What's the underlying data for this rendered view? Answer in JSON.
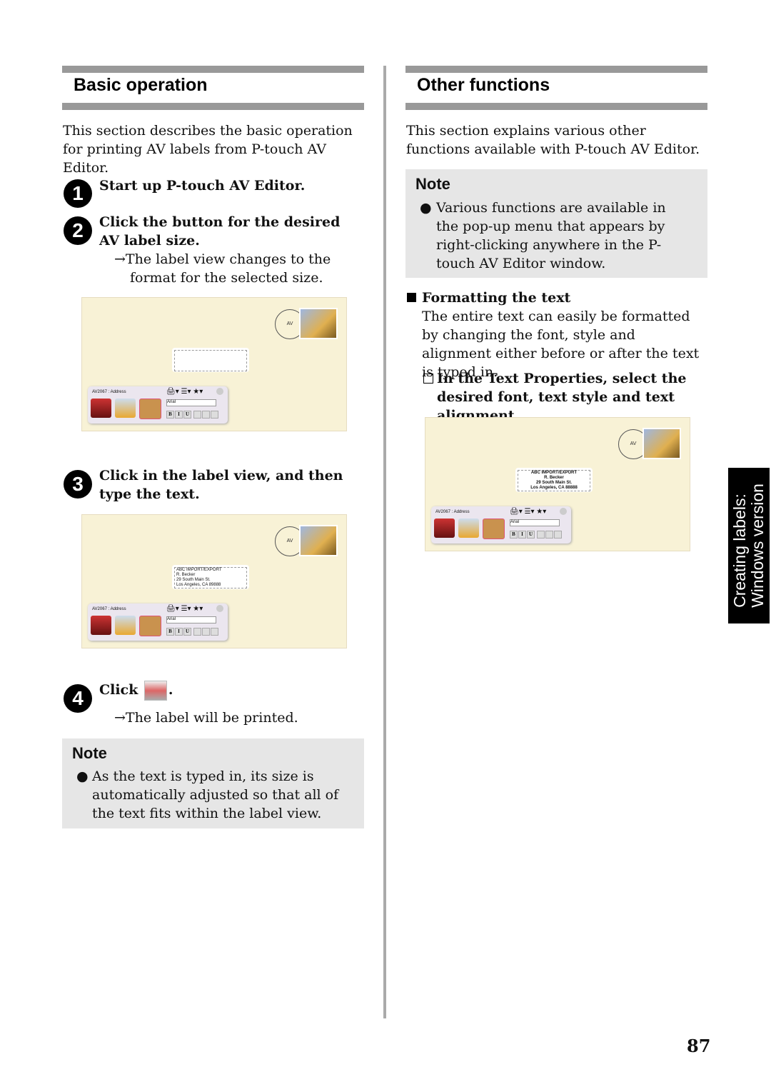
{
  "left": {
    "title": "Basic operation",
    "intro": "This section describes the basic operation for printing AV labels from P-touch AV Editor.",
    "steps": [
      {
        "num": "1",
        "text": "Start up P-touch AV Editor."
      },
      {
        "num": "2",
        "text": "Click the button for the desired AV label size.",
        "result": "→The label view changes to the format for the selected size."
      },
      {
        "num": "3",
        "text": "Click in the label view, and then type the text."
      },
      {
        "num": "4",
        "text": "Click",
        "after": ".",
        "result": "→The label will be printed."
      }
    ],
    "note": {
      "title": "Note",
      "bullet": "●",
      "text": "As the text is typed in, its size is automatically adjusted so that all of the text fits within the label view."
    }
  },
  "right": {
    "title": "Other functions",
    "intro": "This section explains various other functions available with P-touch AV Editor.",
    "note": {
      "title": "Note",
      "bullet": "●",
      "text": "Various functions are available in the pop-up menu that appears by right-clicking anywhere in the P-touch AV Editor window."
    },
    "subheading": "Formatting the text",
    "subtext": "The entire text can easily be formatted by changing the font, style and alignment either before or after the text is typed in.",
    "instruction": "In the Text Properties, select the desired font, text style and text alignment."
  },
  "screens": {
    "postmark": "AV",
    "palette_title_1": "AV2067 : Address",
    "palette_title_3": "AV2067 : Address",
    "palette_title_r": "AV2067 : Address",
    "font": "Arial",
    "bold": "B",
    "italic": "I",
    "underline": "U",
    "address_small": [
      "ABC IMPORT/EXPORT",
      "R. Becker",
      "29 South Main St.",
      "Los Angeles, CA 89888"
    ],
    "address_right": [
      "ABC IMPORT/EXPORT",
      "R. Becker",
      "29 South Main St.",
      "Los Angeles, CA 88888"
    ]
  },
  "side_tab": {
    "line1": "Creating labels:",
    "line2": "Windows version"
  },
  "page_number": "87"
}
